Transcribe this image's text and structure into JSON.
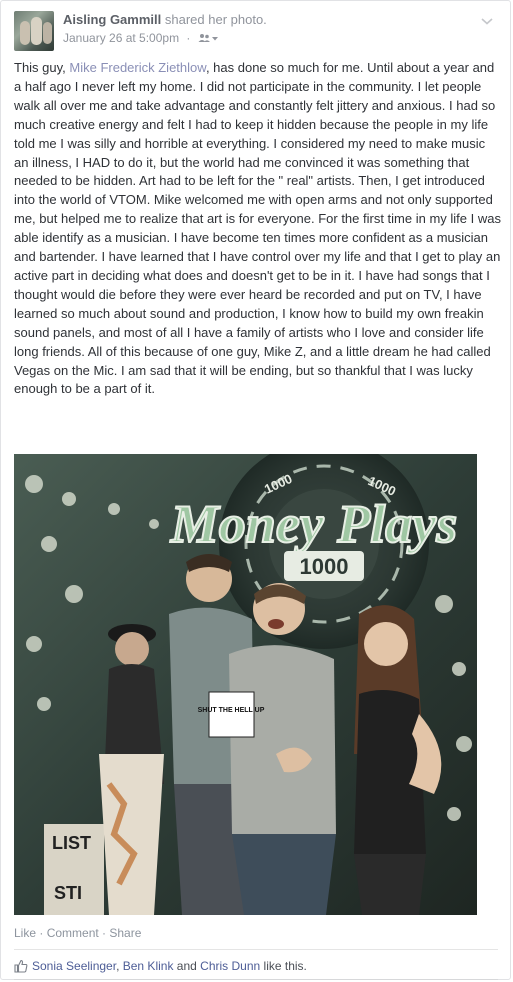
{
  "post": {
    "author": "Aisling Gammill",
    "action": "shared her photo.",
    "date": "January 26 at 5:00pm",
    "separator": "·",
    "text_parts": {
      "p1": "This guy, ",
      "mention": "Mike Frederick Ziethlow",
      "p2": ", has done so much for me. Until about a year and a half ago I never left my home. I did not participate in the community. I let people walk all over me and take advantage and constantly felt jittery and anxious. I had so much creative energy and felt I had to keep it hidden because the people in my life told me I was silly and horrible at everything. I considered my need to make music an illness, I HAD to do it, but the world had me convinced it was something that needed to be hidden. Art had to be left for the \" real\" artists. Then, I get introduced into the world of VTOM. Mike welcomed me with open arms and not only supported me, but helped me to realize that art is for everyone. For the first time in my life I was able identify as a musician. I have become ten times more confident as a musician and bartender. I have learned that I have control over my life and that I get to play an active part in deciding what does and doesn't get to be in it. I have had songs that I thought would die before they were ever heard be recorded and put on TV, I have learned so much about sound and production, I know how to build my own freakin sound panels, and most of all I have a family of artists who I love and consider life long friends. All of this because of one guy, Mike Z, and a little dream he had called Vegas on the Mic. I am sad that it will be ending, but so thankful that I was lucky enough to be a part of it."
    },
    "photo": {
      "sign_line1": "Money Plays",
      "sign_line2": "1000",
      "chip_value": "1000",
      "card_text": "SHUT THE HELL UP",
      "poster_text1": "LIST",
      "poster_text2": "STI"
    },
    "actions": {
      "like": "Like",
      "comment": "Comment",
      "share": "Share",
      "dot": " · "
    },
    "likes": {
      "person1": "Sonia Seelinger",
      "comma": ", ",
      "person2": "Ben Klink",
      "and": " and ",
      "person3": "Chris Dunn",
      "suffix": " like this."
    }
  },
  "icons": {
    "audience": "friends-icon",
    "menu": "chevron-down-icon",
    "like": "thumbs-up-icon"
  },
  "colors": {
    "link": "#8a8fb6",
    "meta": "#90949c",
    "sign_green": "#9fc7a3"
  }
}
